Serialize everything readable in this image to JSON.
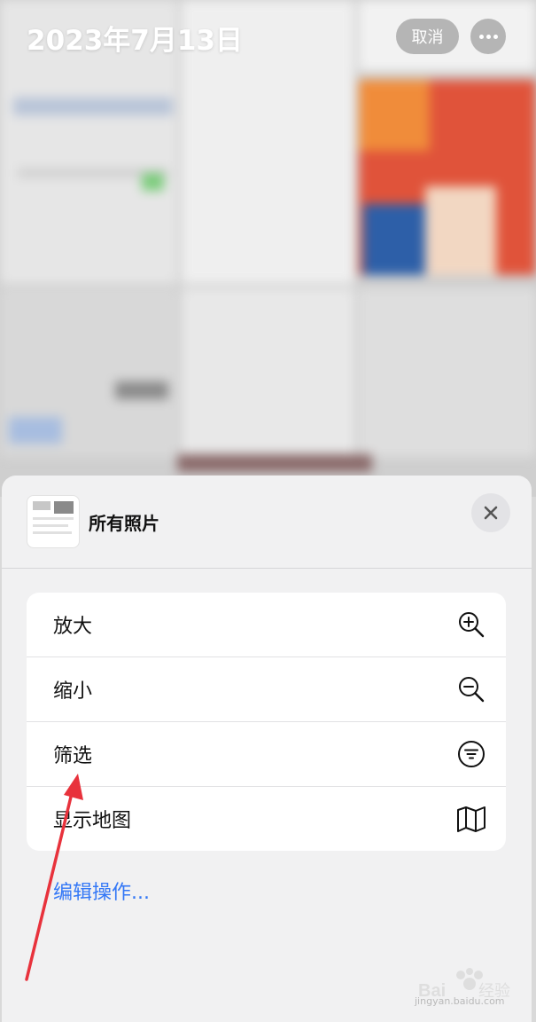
{
  "header": {
    "date_title": "2023年7月13日",
    "cancel_label": "取消",
    "more_icon": "ellipsis-icon"
  },
  "sheet": {
    "title": "所有照片",
    "close_icon": "close-icon",
    "menu": [
      {
        "label": "放大",
        "icon": "zoom-in-icon"
      },
      {
        "label": "缩小",
        "icon": "zoom-out-icon"
      },
      {
        "label": "筛选",
        "icon": "filter-icon"
      },
      {
        "label": "显示地图",
        "icon": "map-icon"
      }
    ],
    "edit_actions_label": "编辑操作..."
  },
  "watermark": {
    "text": "Bai du 经验",
    "sub": "jingyan.baidu.com"
  },
  "colors": {
    "accent": "#3478f6",
    "annotation_arrow": "#e8323c"
  }
}
